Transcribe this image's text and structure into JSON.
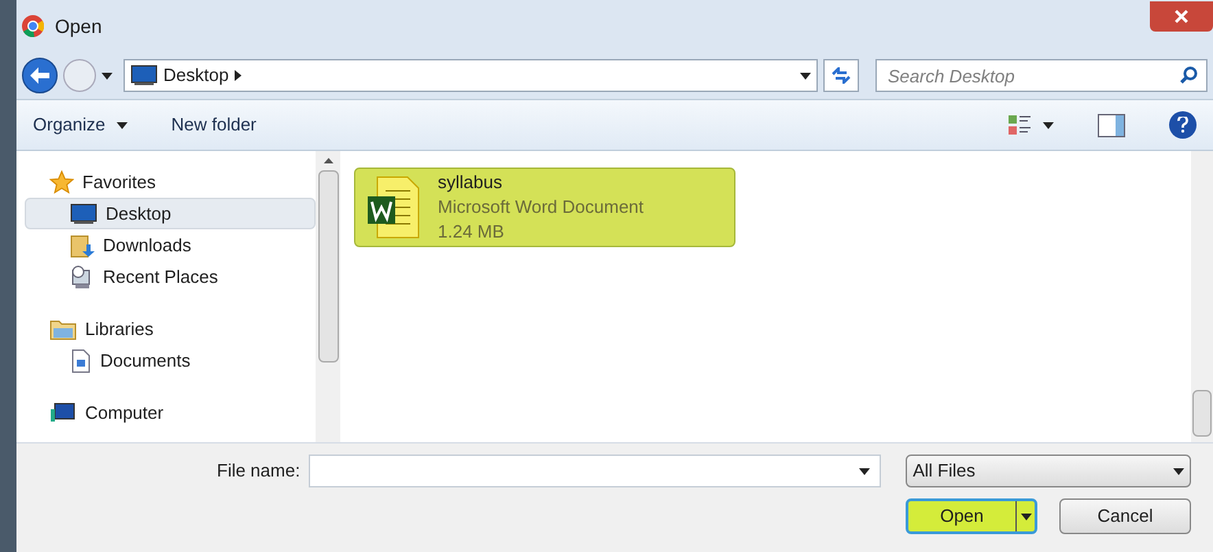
{
  "window": {
    "title": "Open"
  },
  "address": {
    "location": "Desktop"
  },
  "search": {
    "placeholder": "Search Desktop"
  },
  "toolbar": {
    "organize": "Organize",
    "new_folder": "New folder"
  },
  "sidebar": {
    "groups": [
      {
        "label": "Favorites",
        "kind": "star",
        "children": [
          {
            "label": "Desktop",
            "kind": "desktop",
            "selected": true
          },
          {
            "label": "Downloads",
            "kind": "downloads",
            "selected": false
          },
          {
            "label": "Recent Places",
            "kind": "recent",
            "selected": false
          }
        ]
      },
      {
        "label": "Libraries",
        "kind": "library",
        "children": [
          {
            "label": "Documents",
            "kind": "document",
            "selected": false
          }
        ]
      },
      {
        "label": "Computer",
        "kind": "computer"
      }
    ]
  },
  "files": [
    {
      "name": "syllabus",
      "type": "Microsoft Word Document",
      "size": "1.24 MB",
      "selected": true
    }
  ],
  "footer": {
    "file_name_label": "File name:",
    "file_type": "All Files",
    "open": "Open",
    "cancel": "Cancel"
  }
}
